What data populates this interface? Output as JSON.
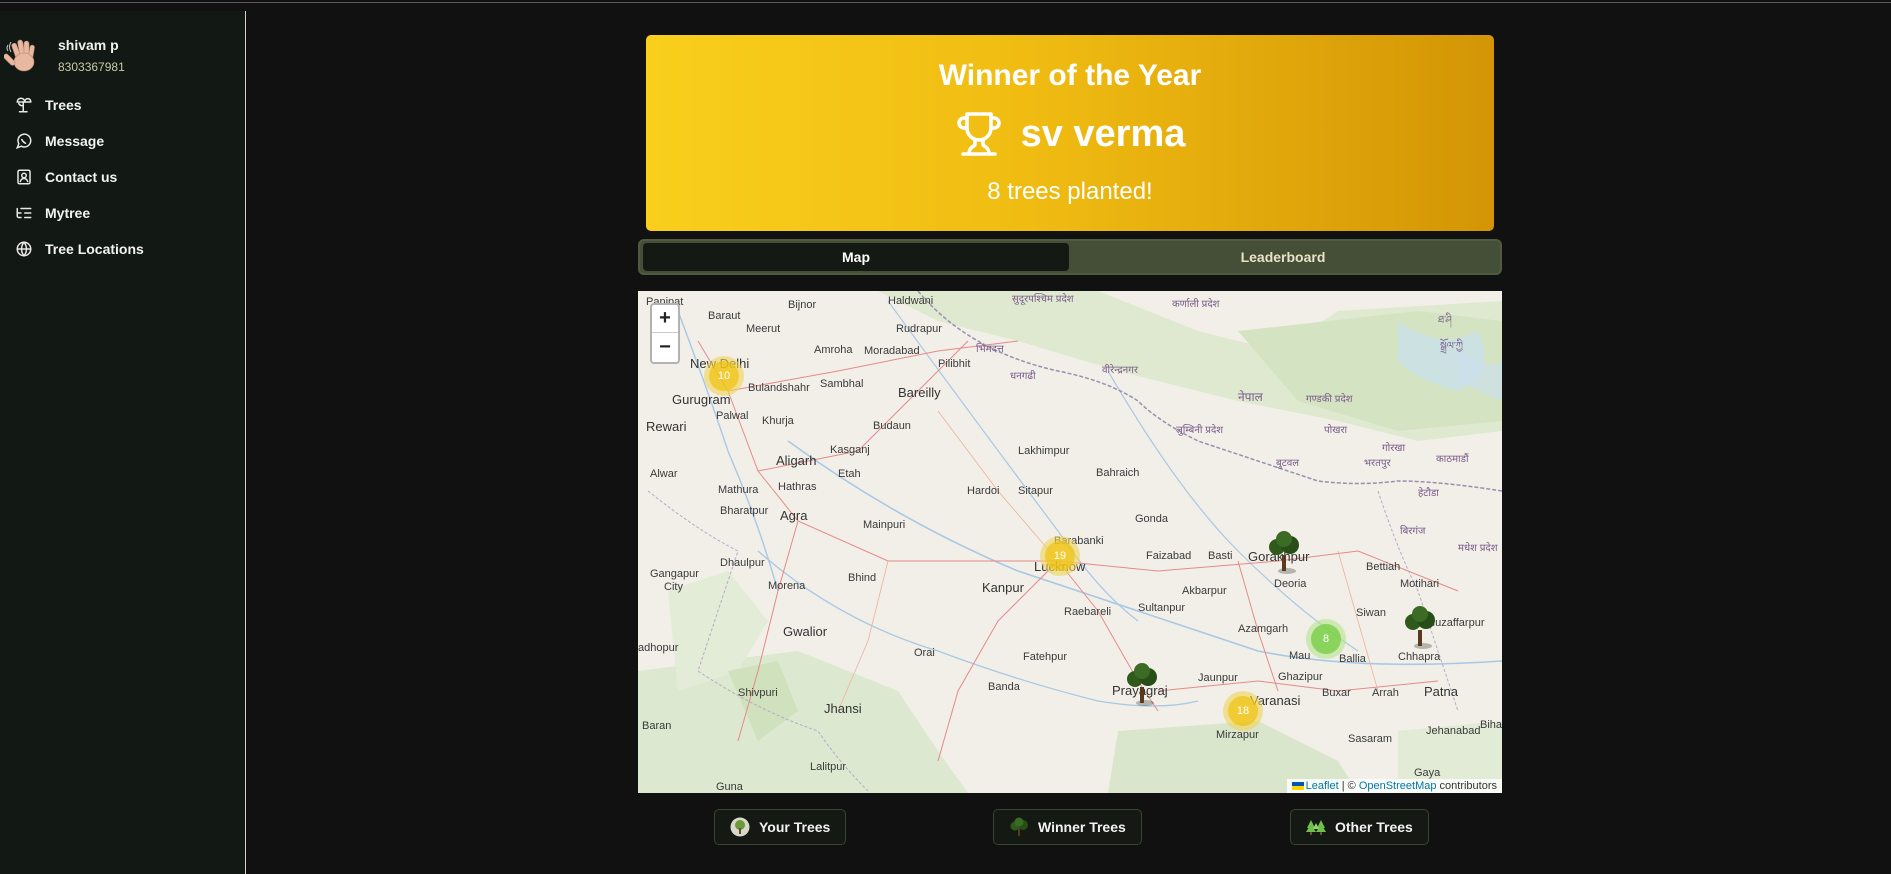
{
  "sidebar": {
    "user": {
      "name": "shivam p",
      "phone": "8303367981"
    },
    "items": [
      {
        "label": "Trees",
        "icon": "palm-tree-icon"
      },
      {
        "label": "Message",
        "icon": "chat-icon"
      },
      {
        "label": "Contact us",
        "icon": "contact-icon"
      },
      {
        "label": "Mytree",
        "icon": "list-tree-icon"
      },
      {
        "label": "Tree Locations",
        "icon": "globe-icon"
      }
    ]
  },
  "banner": {
    "title": "Winner of the Year",
    "winner": "sv verma",
    "count_text": "8 trees planted!"
  },
  "tabs": {
    "map": "Map",
    "leaderboard": "Leaderboard",
    "active": "map"
  },
  "map": {
    "zoom_in": "+",
    "zoom_out": "−",
    "attribution": {
      "leaflet": "Leaflet",
      "sep": " | © ",
      "osm": "OpenStreetMap",
      "suffix": " contributors"
    },
    "clusters": [
      {
        "count": "10",
        "color": "yellow"
      },
      {
        "count": "19",
        "color": "yellow"
      },
      {
        "count": "8",
        "color": "green"
      },
      {
        "count": "18",
        "color": "yellow"
      }
    ],
    "places": {
      "panipat": "Panipat",
      "baraut": "Baraut",
      "bijnor": "Bijnor",
      "haldwani": "Haldwani",
      "rudrapur": "Rudrapur",
      "meerut": "Meerut",
      "amroha": "Amroha",
      "moradabad": "Moradabad",
      "pilibhit": "Pilibhit",
      "new_delhi": "New Delhi",
      "bulandshahr": "Bulandshahr",
      "sambhal": "Sambhal",
      "bareilly": "Bareilly",
      "gurugram": "Gurugram",
      "palwal": "Palwal",
      "rewari": "Rewari",
      "khurja": "Khurja",
      "budaun": "Budaun",
      "kasganj": "Kasganj",
      "aligarh": "Aligarh",
      "etah": "Etah",
      "alwar": "Alwar",
      "mathura": "Mathura",
      "hathras": "Hathras",
      "hardoi": "Hardoi",
      "sitapur": "Sitapur",
      "lakhimpur": "Lakhimpur",
      "bahraich": "Bahraich",
      "bharatpur": "Bharatpur",
      "agra": "Agra",
      "mainpuri": "Mainpuri",
      "gonda": "Gonda",
      "barabanki": "Barabanki",
      "lucknow": "Lucknow",
      "faizabad": "Faizabad",
      "basti": "Basti",
      "gorakhpur": "Gorakhpur",
      "dhaulpur": "Dhaulpur",
      "gangapur": "Gangapur",
      "city": "City",
      "morena": "Morena",
      "bhind": "Bhind",
      "kanpur": "Kanpur",
      "akbarpur": "Akbarpur",
      "deoria": "Deoria",
      "bettiah": "Bettiah",
      "motihari": "Motihari",
      "raebareli": "Raebareli",
      "sultanpur": "Sultanpur",
      "siwan": "Siwan",
      "muzaffarpur": "Muzaffarpur",
      "gwalior": "Gwalior",
      "azamgarh": "Azamgarh",
      "mau": "Mau",
      "ballia": "Ballia",
      "chhapra": "Chhapra",
      "adhopur": "adhopur",
      "orai": "Orai",
      "fatehpur": "Fatehpur",
      "ghazipur": "Ghazipur",
      "jaunpur": "Jaunpur",
      "banda": "Banda",
      "prayagraj": "Prayagraj",
      "varanasi": "Varanasi",
      "buxar": "Buxar",
      "arrah": "Arrah",
      "patna": "Patna",
      "shivpuri": "Shivpuri",
      "jhansi": "Jhansi",
      "baran": "Baran",
      "mirzapur": "Mirzapur",
      "sasaram": "Sasaram",
      "jehanabad": "Jehanabad",
      "bihar": "Biha",
      "lalitpur": "Lalitpur",
      "guna": "Guna",
      "gaya": "Gaya",
      "dev_sudurpashchim": "सुदूरपश्चिम प्रदेश",
      "dev_karnali": "कर्णाली प्रदेश",
      "dev_bhimdatt": "भिमदत्त",
      "dev_dhangadhi": "धनगढी",
      "dev_birendranagar": "वीरेन्द्रनगर",
      "dev_nepal": "नेपाल",
      "dev_gandaki": "गण्डकी प्रदेश",
      "dev_pokhara": "पोखरा",
      "dev_lumbini": "लुम्बिनी प्रदेश",
      "dev_gorkha": "गोरखा",
      "dev_bharatpur": "भरतपुर",
      "dev_kathmandu": "काठमाडौं",
      "dev_butwal": "बुटवल",
      "dev_hetauda": "हेटौडा",
      "dev_birgunj": "बिरगंज",
      "dev_madhesh": "मधेश प्रदेश",
      "tib_1": "ཐ་ཤི",
      "tib_2": "སྒྲོལ་ཀྱི"
    }
  },
  "legend": [
    {
      "label": "Your Trees",
      "icon": "your-tree-icon"
    },
    {
      "label": "Winner Trees",
      "icon": "winner-tree-icon"
    },
    {
      "label": "Other Trees",
      "icon": "other-trees-icon"
    }
  ],
  "colors": {
    "banner_start": "#f9cf1c",
    "banner_end": "#d39505",
    "sidebar_bg": "#121813",
    "tab_bg": "#454e36"
  }
}
